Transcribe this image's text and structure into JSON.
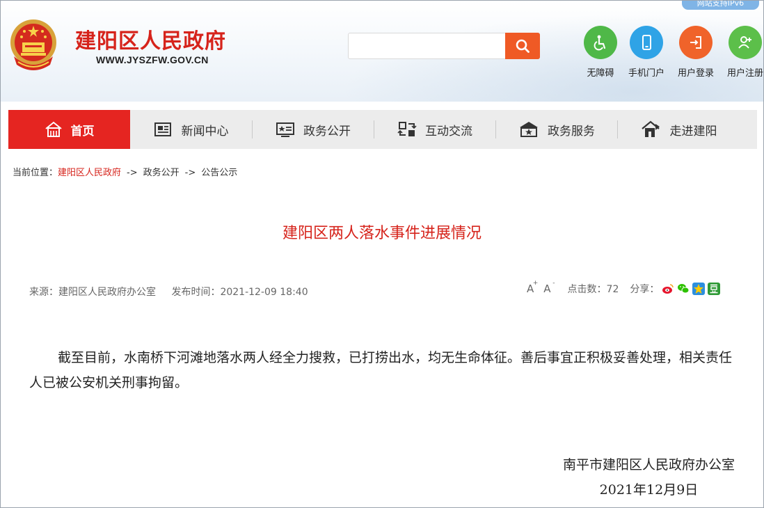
{
  "header": {
    "site_name": "建阳区人民政府",
    "site_url": "WWW.JYSZFW.GOV.CN",
    "ipv6_badge": "网站支持IPv6",
    "search": {
      "placeholder": "",
      "button_icon": "search-icon"
    },
    "tools": [
      {
        "label": "无障碍",
        "icon": "accessibility-icon",
        "color": "#4fb848"
      },
      {
        "label": "手机门户",
        "icon": "mobile-icon",
        "color": "#2fa3e6"
      },
      {
        "label": "用户登录",
        "icon": "login-icon",
        "color": "#f0632a"
      },
      {
        "label": "用户注册",
        "icon": "register-icon",
        "color": "#5cbf4a"
      }
    ]
  },
  "nav": {
    "items": [
      {
        "label": "首页",
        "icon": "home-icon",
        "active": true
      },
      {
        "label": "新闻中心",
        "icon": "news-icon"
      },
      {
        "label": "政务公开",
        "icon": "gov-open-icon"
      },
      {
        "label": "互动交流",
        "icon": "interaction-icon"
      },
      {
        "label": "政务服务",
        "icon": "service-icon"
      },
      {
        "label": "走进建阳",
        "icon": "about-icon"
      }
    ]
  },
  "breadcrumb": {
    "prefix": "当前位置：",
    "items": [
      "建阳区人民政府",
      "政务公开",
      "公告公示"
    ],
    "separator": "->"
  },
  "article": {
    "title": "建阳区两人落水事件进展情况",
    "source": "来源：建阳区人民政府办公室",
    "publish_time": "发布时间：2021-12-09 18:40",
    "font_increase": "A",
    "font_decrease": "A",
    "clicks_label": "点击数：72",
    "share_label": "分享：",
    "share_icons": [
      "weibo-icon",
      "wechat-icon",
      "qzone-icon",
      "douban-icon"
    ],
    "body": "截至目前，水南桥下河滩地落水两人经全力搜救，已打捞出水，均无生命体征。善后事宜正积极妥善处理，相关责任人已被公安机关刑事拘留。",
    "sign_org": "南平市建阳区人民政府办公室",
    "sign_date": "2021年12月9日"
  },
  "colors": {
    "brand_red": "#d6231b",
    "nav_active": "#e52521",
    "search_button": "#ef5a25"
  }
}
